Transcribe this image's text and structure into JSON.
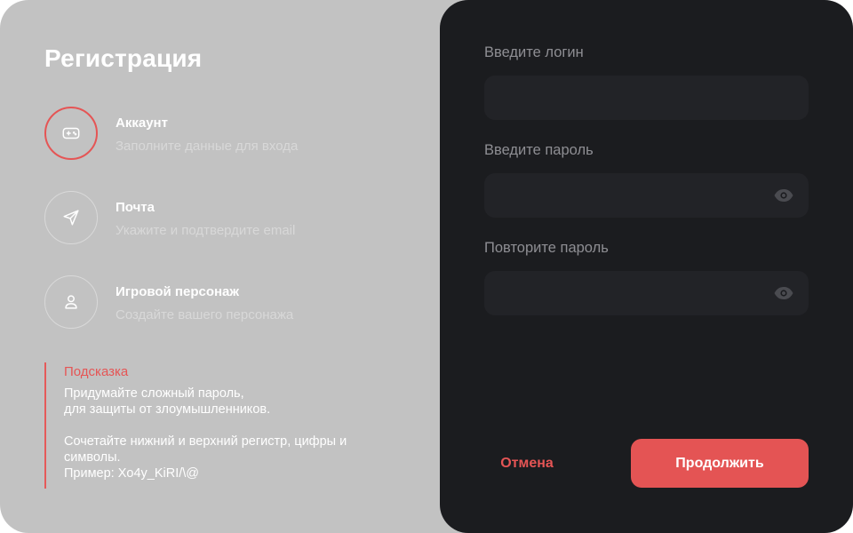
{
  "page": {
    "title": "Регистрация"
  },
  "steps": [
    {
      "title": "Аккаунт",
      "description": "Заполните данные для входа",
      "icon": "gamepad-icon",
      "active": true
    },
    {
      "title": "Почта",
      "description": "Укажите и подтвердите email",
      "icon": "paper-plane-icon",
      "active": false
    },
    {
      "title": "Игровой персонаж",
      "description": "Создайте вашего персонажа",
      "icon": "user-icon",
      "active": false
    }
  ],
  "hint": {
    "title": "Подсказка",
    "lines": [
      "Придумайте сложный пароль,",
      "для защиты от злоумышленников.",
      "Сочетайте нижний и верхний регистр, цифры и",
      "символы.",
      "Пример: Xo4y_KiRI/\\@"
    ]
  },
  "form": {
    "login_label": "Введите логин",
    "login_value": "",
    "password_label": "Введите пароль",
    "password_value": "",
    "repeat_label": "Повторите пароль",
    "repeat_value": ""
  },
  "actions": {
    "cancel_label": "Отмена",
    "continue_label": "Продолжить"
  },
  "colors": {
    "accent": "#e55555",
    "left_panel": "#c2c2c2",
    "right_panel": "#1b1c1f",
    "field_bg": "#222327"
  }
}
